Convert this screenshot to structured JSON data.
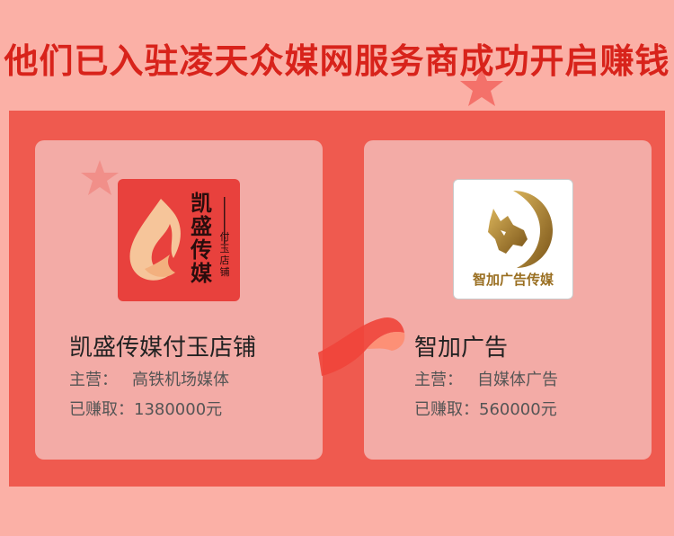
{
  "headline": "他们已入驻凌天众媒网服务商成功开启赚钱",
  "cards": [
    {
      "name": "凯盛传媒付玉店铺",
      "main_label": "主营：",
      "main_value": "高铁机场媒体",
      "earn_label": "已赚取：",
      "earn_value": "1380000元",
      "logo": {
        "brand_chars": [
          "凯",
          "盛",
          "传",
          "媒"
        ],
        "sub_chars": [
          "付",
          "玉",
          "店",
          "铺"
        ],
        "icon": "flame-logo-icon",
        "bg_color": "#e8413d"
      }
    },
    {
      "name": "智加广告",
      "main_label": "主营：",
      "main_value": "自媒体广告",
      "earn_label": "已赚取：",
      "earn_value": "560000元",
      "logo": {
        "brand_text": "智加广告传媒",
        "icon": "wolf-moon-logo-icon",
        "accent_color": "#a07a2a"
      }
    }
  ],
  "colors": {
    "background": "#fbb0a6",
    "panel": "#ef5a4f",
    "card": "#f3aba6",
    "headline": "#d8231b"
  }
}
